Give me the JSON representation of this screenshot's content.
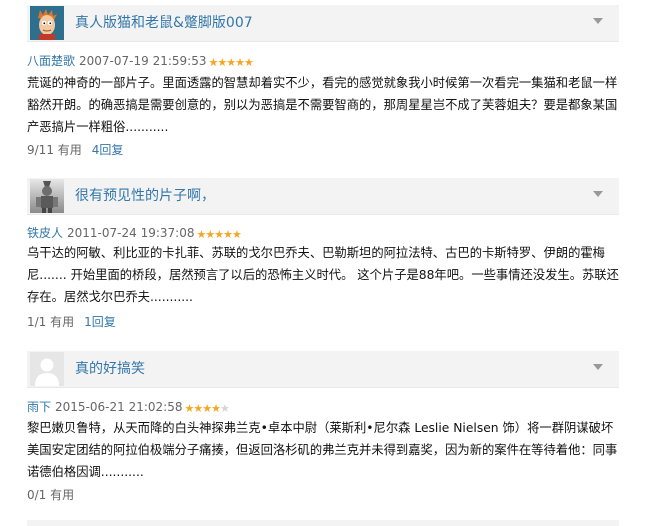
{
  "reviews": [
    {
      "title": "真人版猫和老鼠&蹩脚版007",
      "author": "八面楚歌",
      "date": "2007-07-19 21:59:53",
      "rating": 5,
      "max_rating": 5,
      "text": "荒诞的神奇的一部片子。里面透露的智慧却着实不少，看完的感觉就象我小时候第一次看完一集猫和老鼠一样豁然开朗。的确恶搞是需要创意的，别以为恶搞是不需要智商的，那周星星岂不成了芙蓉姐夫？要是都象某国产恶搞片一样粗俗...........",
      "useful": "9/11 有用",
      "replies": "4回复",
      "avatar": "futurama-fry-avatar"
    },
    {
      "title": "很有预见性的片子啊，",
      "author": "铁皮人",
      "date": "2011-07-24 19:37:08",
      "rating": 5,
      "max_rating": 5,
      "text": "乌干达的阿敏、利比亚的卡扎菲、苏联的戈尔巴乔夫、巴勒斯坦的阿拉法特、古巴的卡斯特罗、伊朗的霍梅尼....... 开始里面的桥段，居然预言了以后的恐怖主义时代。 这个片子是88年吧。一些事情还没发生。苏联还存在。居然戈尔巴乔夫...........",
      "useful": "1/1 有用",
      "replies": "1回复",
      "avatar": "tin-man-avatar"
    },
    {
      "title": "真的好搞笑",
      "author": "雨下",
      "date": "2015-06-21 21:02:58",
      "rating": 4,
      "max_rating": 5,
      "text": "黎巴嫩贝鲁特，从天而降的白头神探弗兰克•卓本中尉（莱斯利•尼尔森 Leslie Nielsen 饰）将一群阴谋破坏美国安定团结的阿拉伯极端分子痛揍，但返回洛杉矶的弗兰克并未得到嘉奖，因为新的案件在等待着他：同事诺德伯格因调...........",
      "useful": "0/1 有用",
      "replies": "",
      "avatar": "default-user-avatar"
    }
  ],
  "colors": {
    "link": "#3377aa",
    "star": "#f5a623",
    "header_bg": "#f3f3f3"
  }
}
